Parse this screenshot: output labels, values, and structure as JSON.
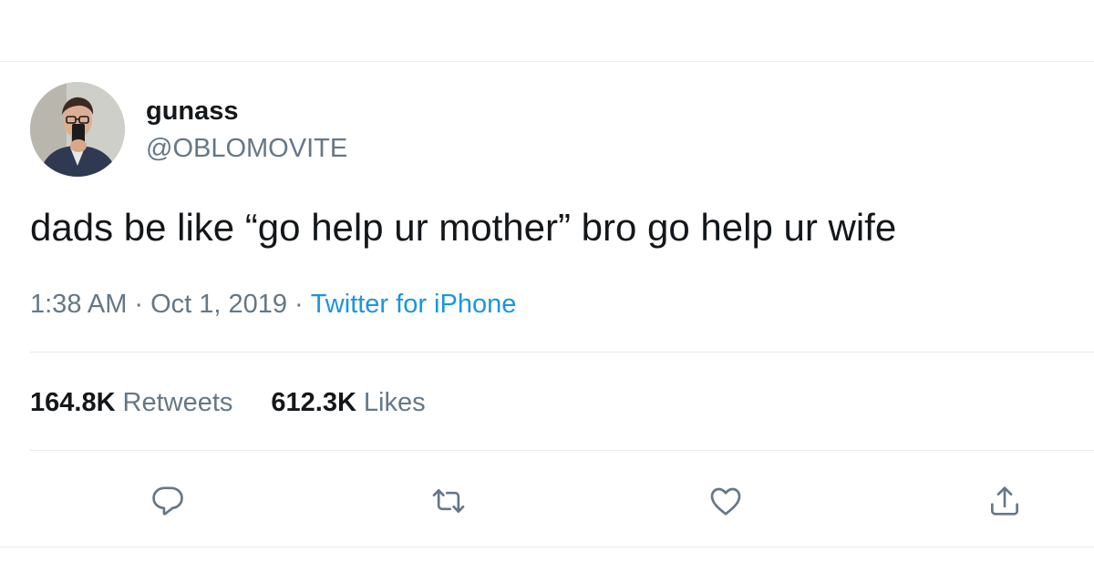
{
  "tweet": {
    "author": {
      "display_name": "gunass",
      "handle": "@OBLOMOVITE",
      "avatar_icon": "profile-photo"
    },
    "text": "dads be like “go help ur mother” bro go help ur wife",
    "time": "1:38 AM",
    "date": "Oct 1, 2019",
    "separator": "·",
    "source": "Twitter for iPhone",
    "stats": {
      "retweets_count": "164.8K",
      "retweets_label": "Retweets",
      "likes_count": "612.3K",
      "likes_label": "Likes"
    },
    "actions": [
      {
        "name": "reply",
        "icon": "speech-bubble-icon"
      },
      {
        "name": "retweet",
        "icon": "retweet-arrows-icon"
      },
      {
        "name": "like",
        "icon": "heart-icon"
      },
      {
        "name": "share",
        "icon": "share-upload-icon"
      }
    ]
  },
  "colors": {
    "text_primary": "#14171a",
    "text_secondary": "#657786",
    "link": "#1b95e0",
    "divider": "#e6ecf0",
    "icon": "#657786"
  }
}
